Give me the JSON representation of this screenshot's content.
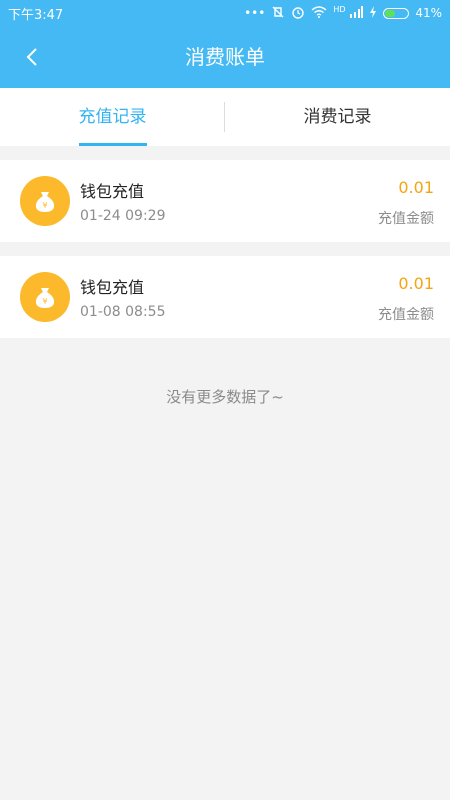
{
  "status_bar": {
    "time": "下午3:47",
    "battery_percent": "41%",
    "network_label": "HD"
  },
  "header": {
    "title": "消费账单"
  },
  "tabs": [
    {
      "label": "充值记录",
      "active": true
    },
    {
      "label": "消费记录",
      "active": false
    }
  ],
  "records": [
    {
      "title": "钱包充值",
      "time": "01-24 09:29",
      "amount": "0.01",
      "type": "充值金额"
    },
    {
      "title": "钱包充值",
      "time": "01-08 08:55",
      "amount": "0.01",
      "type": "充值金额"
    }
  ],
  "footer": {
    "no_more": "没有更多数据了~"
  },
  "colors": {
    "primary": "#44b9f3",
    "accent": "#33b4f2",
    "amount": "#f4a511",
    "coin": "#fbb92b"
  }
}
